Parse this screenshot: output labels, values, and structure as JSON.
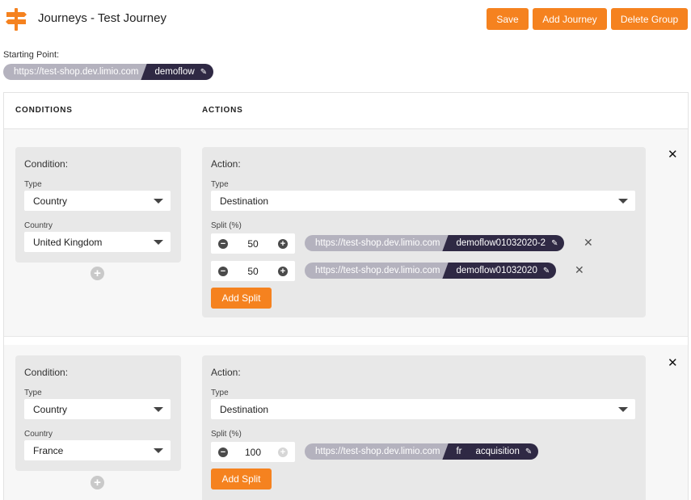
{
  "header": {
    "title": "Journeys - Test Journey",
    "save_label": "Save",
    "add_journey_label": "Add Journey",
    "delete_group_label": "Delete Group",
    "accent_color": "#f5821f"
  },
  "starting_point": {
    "label": "Starting Point:",
    "base_url": "https://test-shop.dev.limio.com",
    "path": "demoflow"
  },
  "columns": {
    "conditions": "CONDITIONS",
    "actions": "ACTIONS"
  },
  "rows": [
    {
      "condition": {
        "title": "Condition:",
        "type_label": "Type",
        "type_value": "Country",
        "country_label": "Country",
        "country_value": "United Kingdom"
      },
      "action": {
        "title": "Action:",
        "type_label": "Type",
        "type_value": "Destination",
        "split_label": "Split (%)",
        "splits": [
          {
            "value": "50",
            "base_url": "https://test-shop.dev.limio.com",
            "path": "demoflow01032020-2"
          },
          {
            "value": "50",
            "base_url": "https://test-shop.dev.limio.com",
            "path": "demoflow01032020"
          }
        ],
        "add_split_label": "Add Split"
      }
    },
    {
      "condition": {
        "title": "Condition:",
        "type_label": "Type",
        "type_value": "Country",
        "country_label": "Country",
        "country_value": "France"
      },
      "action": {
        "title": "Action:",
        "type_label": "Type",
        "type_value": "Destination",
        "split_label": "Split (%)",
        "splits": [
          {
            "value": "100",
            "base_url": "https://test-shop.dev.limio.com",
            "segment1": "fr",
            "segment2": "acquisition"
          }
        ],
        "add_split_label": "Add Split"
      }
    }
  ]
}
